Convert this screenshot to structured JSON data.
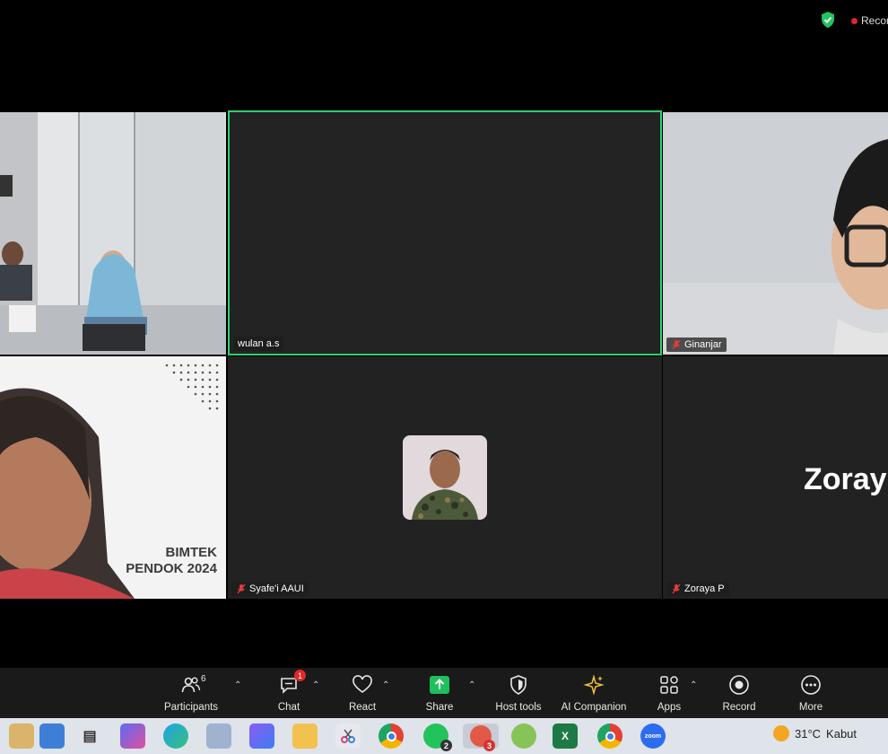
{
  "topbar": {
    "recording_label": "Recor"
  },
  "participants": [
    {
      "name": ""
    },
    {
      "name": "wulan a.s"
    },
    {
      "name": "Ginanjar"
    },
    {
      "name": ""
    },
    {
      "name": "Syafe'i AAUI"
    },
    {
      "name": "Zoraya P"
    }
  ],
  "tiles": {
    "banner_line1": "BIMTEK",
    "banner_line2": "PENDOK 2024",
    "zoraya_big": "Zoray"
  },
  "toolbar": {
    "participants": {
      "label": "Participants",
      "count": "6"
    },
    "chat": {
      "label": "Chat",
      "badge": "1"
    },
    "react": {
      "label": "React"
    },
    "share": {
      "label": "Share"
    },
    "host_tools": {
      "label": "Host tools"
    },
    "ai_companion": {
      "label": "AI Companion"
    },
    "apps": {
      "label": "Apps"
    },
    "record": {
      "label": "Record"
    },
    "more": {
      "label": "More"
    }
  },
  "taskbar": {
    "whatsapp_badge": "2",
    "app_badge": "3",
    "weather_temp": "31°C",
    "weather_desc": "Kabut"
  },
  "colors": {
    "active_speaker": "#2fd06b",
    "share_green": "#1fbf5b",
    "badge_red": "#e02828"
  }
}
